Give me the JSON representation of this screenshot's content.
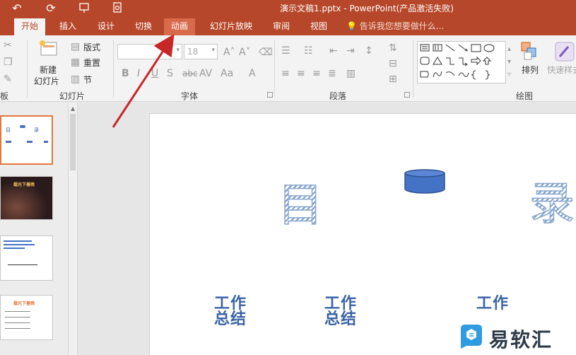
{
  "window": {
    "title": "演示文稿1.pptx - PowerPoint(产品激活失败)"
  },
  "tabs": [
    "开始",
    "插入",
    "设计",
    "切换",
    "动画",
    "幻灯片放映",
    "审阅",
    "视图"
  ],
  "tell_me": "告诉我您想要做什么...",
  "ribbon": {
    "slides_group": {
      "new_slide_line1": "新建",
      "new_slide_line2": "幻灯片",
      "layout": "版式",
      "reset": "重置",
      "section": "节",
      "label": "幻灯片"
    },
    "clipboard_label": "板",
    "font_group": {
      "size": "18",
      "label": "字体"
    },
    "paragraph_label": "段落",
    "drawing_group": {
      "arrange": "排列",
      "quick_styles": "快速样式",
      "label": "绘图"
    }
  },
  "slide": {
    "title_left": "目",
    "title_right": "录",
    "items": [
      {
        "line1": "工作",
        "line2": "总结"
      },
      {
        "line1": "工作",
        "line2": "总结"
      },
      {
        "line1": "工作",
        "line2": ""
      }
    ]
  },
  "thumbnails": {
    "t1": {
      "left": "目",
      "right": "录"
    },
    "t2": {
      "title": "载光下着晚"
    },
    "t4": {
      "title": "载光下着晚"
    }
  },
  "watermark": "易软汇",
  "colors": {
    "accent": "#b7472a",
    "highlight_tab": "#d86a4c",
    "arrow": "#c62828",
    "slide_text": "#3b63a6"
  }
}
